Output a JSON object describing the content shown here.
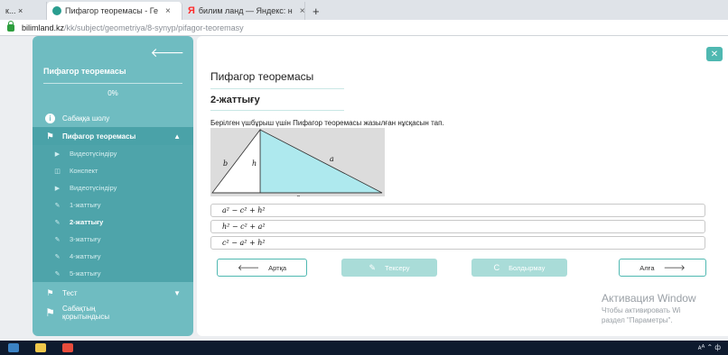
{
  "browser": {
    "tabs": [
      {
        "label": "к... ×",
        "active": false,
        "favicon_color": "#9aa3ad"
      },
      {
        "label": "Пифагор теоремасы - Ге",
        "active": true,
        "favicon_color": "#2a9d8f"
      },
      {
        "label": "билим ланд — Яндекс: н",
        "active": false,
        "favicon_icon": "yandex-icon"
      }
    ],
    "close_glyph": "×",
    "new_tab_glyph": "+",
    "yandex_glyph": "Я",
    "url_host": "bilimland.kz",
    "url_path": "/kk/subject/geometriya/8-synyp/pifagor-teoremasy"
  },
  "sidebar": {
    "back_glyph": "🡐",
    "title": "Пифагор теоремасы",
    "progress": "0%",
    "lesson_link": "Сабаққа шолу",
    "section_label": "Пифагор теоремасы",
    "items": [
      {
        "label": "Видеотүсіндіру",
        "icon": "play-icon",
        "glyph": "▶",
        "active": false
      },
      {
        "label": "Конспект",
        "icon": "book-icon",
        "glyph": "◫",
        "active": false
      },
      {
        "label": "Видеотүсіндіру",
        "icon": "play-icon",
        "glyph": "▶",
        "active": false
      },
      {
        "label": "1-жаттығу",
        "icon": "edit-icon",
        "glyph": "✎",
        "active": false
      },
      {
        "label": "2-жаттығу",
        "icon": "edit-icon",
        "glyph": "✎",
        "active": true
      },
      {
        "label": "3-жаттығу",
        "icon": "edit-icon",
        "glyph": "✎",
        "active": false
      },
      {
        "label": "4-жаттығу",
        "icon": "edit-icon",
        "glyph": "✎",
        "active": false
      },
      {
        "label": "5-жаттығу",
        "icon": "edit-icon",
        "glyph": "✎",
        "active": false
      }
    ],
    "test_label": "Тест",
    "summary_label_1": "Сабақтың",
    "summary_label_2": "қорытындысы"
  },
  "main": {
    "title": "Пифагор теоремасы",
    "exercise_title": "2-жаттығу",
    "question": "Берілген үшбұрыш үшін Пифагор теоремасы жазылған нұсқасын тап.",
    "figure_labels": {
      "b": "b",
      "h": "h",
      "a": "a",
      "c": "c"
    },
    "options": [
      "a² − c² + h²",
      "h² − c² + a²",
      "c² − a² + h²"
    ],
    "buttons": {
      "back": "Артқа",
      "check": "Тексеру",
      "reset": "Болдырмау",
      "next": "Алға"
    }
  },
  "watermark": {
    "line1": "Активация Window",
    "line2": "Чтобы активировать Wi",
    "line3": "раздел \"Параметры\"."
  },
  "taskbar": {
    "tray": "ᴀᴬ  ⌃  ф"
  },
  "colors": {
    "sidebar_bg": "#6fbcc1",
    "sidebar_active_bg": "#4aa2a8",
    "accent": "#4fb8b1",
    "triangle_fill": "#aee9ee",
    "taskbar": "#0e1a2e"
  }
}
